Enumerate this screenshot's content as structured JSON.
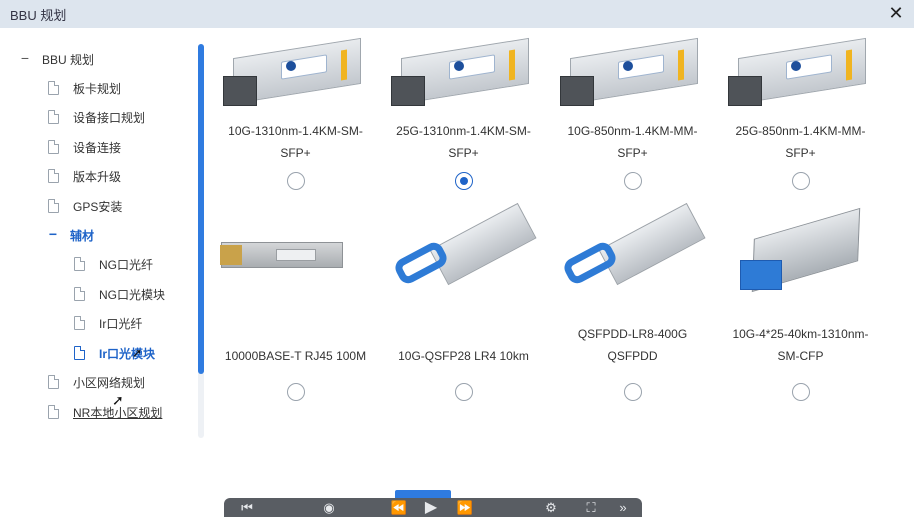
{
  "window": {
    "title": "BBU 规划",
    "close_icon": "close-icon"
  },
  "tree": {
    "root": {
      "label": "BBU 规划",
      "toggle": "−"
    },
    "items": [
      {
        "label": "板卡规划"
      },
      {
        "label": "设备接口规划"
      },
      {
        "label": "设备连接"
      },
      {
        "label": "版本升级"
      },
      {
        "label": "GPS安装"
      }
    ],
    "group": {
      "label": "辅材",
      "toggle": "−"
    },
    "group_items": [
      {
        "label": "NG口光纤"
      },
      {
        "label": "NG口光模块"
      },
      {
        "label": "Ir口光纤"
      },
      {
        "label": "Ir口光模块"
      }
    ],
    "after_items": [
      {
        "label": "小区网络规划"
      },
      {
        "label": "NR本地小区规划"
      }
    ]
  },
  "products": [
    {
      "line1": "10G-1310nm-1.4KM-SM-",
      "line2": "SFP+",
      "checked": false
    },
    {
      "line1": "25G-1310nm-1.4KM-SM-",
      "line2": "SFP+",
      "checked": true
    },
    {
      "line1": "10G-850nm-1.4KM-MM-",
      "line2": "SFP+",
      "checked": false
    },
    {
      "line1": "25G-850nm-1.4KM-MM-",
      "line2": "SFP+",
      "checked": false
    },
    {
      "line1": "10000BASE-T RJ45 100M",
      "line2": "",
      "checked": false
    },
    {
      "line1": "10G-QSFP28 LR4 10km",
      "line2": "",
      "checked": false
    },
    {
      "line1": "QSFPDD-LR8-400G",
      "line2": "QSFPDD",
      "checked": false
    },
    {
      "line1": "10G-4*25-40km-1310nm-",
      "line2": "SM-CFP",
      "checked": false
    }
  ],
  "colors": {
    "accent": "#1e63c8",
    "scrollbar": "#2f7be0",
    "module_blue": "#2e7bd6"
  },
  "video_toolbar": {
    "icons": [
      "skip-back-icon",
      "rewind-icon",
      "play-icon",
      "forward-icon",
      "settings-icon",
      "fullscreen-icon"
    ]
  }
}
